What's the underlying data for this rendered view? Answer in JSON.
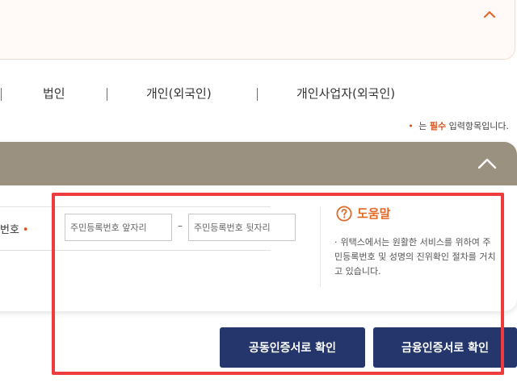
{
  "tabs": [
    {
      "label": "법인"
    },
    {
      "label": "개인(외국인)"
    },
    {
      "label": "개인사업자(외국인)"
    }
  ],
  "required_note": {
    "dot": "•",
    "prefix": "는",
    "emphasis": "필수",
    "suffix": "입력항목입니다."
  },
  "form": {
    "ssn_label": "번호",
    "required_marker": "•",
    "ssn_front_placeholder": "주민등록번호 앞자리",
    "ssn_separator": "–",
    "ssn_back_placeholder": "주민등록번호 뒷자리"
  },
  "help": {
    "title": "도움말",
    "bullet": "·",
    "text": "위택스에서는 원활한 서비스를 위하여 주민등록번호 및 성명의 진위확인 절차를 거치고 있습니다."
  },
  "buttons": {
    "joint_cert": "공동인증서로 확인",
    "financial_cert": "금융인증서로 확인"
  },
  "colors": {
    "accent_orange": "#e06a2a",
    "header_tan": "#9b9180",
    "button_navy": "#24366b",
    "annotation_red": "#ee3b3b"
  },
  "icons": {
    "top_toggle": "chevron-up-icon",
    "card_toggle": "chevron-up-icon",
    "help": "question-circle-icon"
  }
}
